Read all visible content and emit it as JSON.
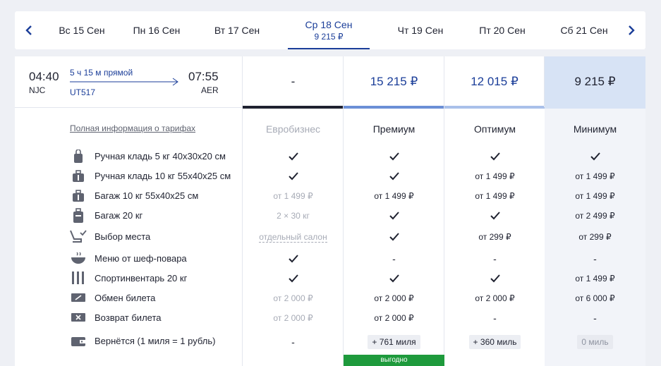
{
  "dates": [
    {
      "label": "Вс 15 Сен"
    },
    {
      "label": "Пн 16 Сен"
    },
    {
      "label": "Вт 17 Сен"
    },
    {
      "label": "Ср 18 Сен",
      "price": "9 215 ₽"
    },
    {
      "label": "Чт 19 Сен"
    },
    {
      "label": "Пт 20 Сен"
    },
    {
      "label": "Сб 21 Сен"
    }
  ],
  "flight": {
    "dep_time": "04:40",
    "dep_code": "NJC",
    "duration": "5 ч 15 м",
    "direct": "прямой",
    "number": "UT517",
    "arr_time": "07:55",
    "arr_code": "AER"
  },
  "prices": [
    "-",
    "15 215 ₽",
    "12 015 ₽",
    "9 215 ₽"
  ],
  "fare_info_link": "Полная информация о тарифах",
  "fares": [
    "Евробизнес",
    "Премиум",
    "Оптимум",
    "Минимум"
  ],
  "rows": [
    {
      "icon": "hand-bag-icon",
      "label": "Ручная кладь 5 кг 40x30x20 см",
      "cells": [
        "✓",
        "✓",
        "✓",
        "✓"
      ]
    },
    {
      "icon": "hand-luggage-icon",
      "label": "Ручная кладь 10 кг 55x40x25 см",
      "cells": [
        "✓",
        "✓",
        "от 1 499 ₽",
        "от 1 499 ₽"
      ]
    },
    {
      "icon": "baggage-10-icon",
      "label": "Багаж 10 кг 55x40x25 см",
      "cells": [
        "от 1 499 ₽",
        "от 1 499 ₽",
        "от 1 499 ₽",
        "от 1 499 ₽"
      ]
    },
    {
      "icon": "baggage-20-icon",
      "label": "Багаж 20 кг",
      "cells": [
        "2 × 30 кг",
        "✓",
        "✓",
        "от 2 499 ₽"
      ]
    },
    {
      "icon": "seat-icon",
      "label": "Выбор места",
      "cells": [
        "отдельный салон",
        "✓",
        "от 299 ₽",
        "от 299 ₽"
      ]
    },
    {
      "icon": "meal-icon",
      "label": "Меню от шеф-повара",
      "cells": [
        "✓",
        "-",
        "-",
        "-"
      ]
    },
    {
      "icon": "sport-icon",
      "label": "Спортинвентарь 20 кг",
      "cells": [
        "✓",
        "✓",
        "✓",
        "от 1 499 ₽"
      ]
    },
    {
      "icon": "exchange-icon",
      "label": "Обмен билета",
      "cells": [
        "от 2 000 ₽",
        "от 2 000 ₽",
        "от 2 000 ₽",
        "от 6 000 ₽"
      ]
    },
    {
      "icon": "refund-icon",
      "label": "Возврат билета",
      "cells": [
        "от 2 000 ₽",
        "от 2 000 ₽",
        "-",
        "-"
      ]
    },
    {
      "icon": "wallet-icon",
      "label": "Вернётся (1 миля = 1 рубль)",
      "cells": [
        "-",
        "+ 761 миля",
        "+ 360 миль",
        "0 миль"
      ]
    }
  ],
  "badge": "выгодно",
  "colors": {
    "accent": "#1b3e99",
    "bar_business": "#1f2230",
    "bar_premium": "#6b8fd6",
    "bar_optimum": "#a9c0ea",
    "minimum_bg": "#d7e3f5",
    "badge": "#1e9a3c"
  }
}
